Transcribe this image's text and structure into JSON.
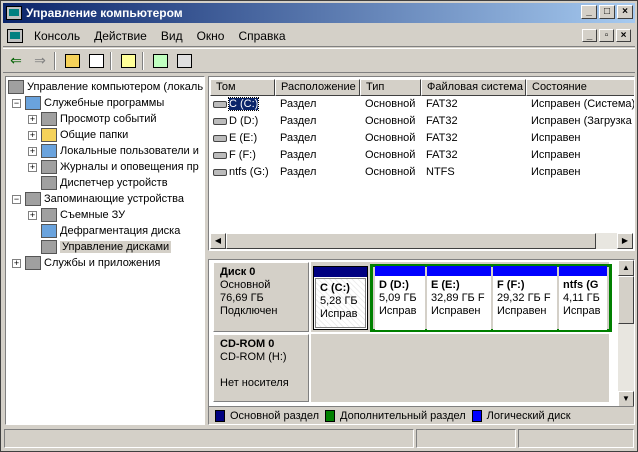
{
  "window": {
    "title": "Управление компьютером"
  },
  "menu": {
    "items": [
      "Консоль",
      "Действие",
      "Вид",
      "Окно",
      "Справка"
    ]
  },
  "tree": {
    "items": [
      {
        "label": "Управление компьютером (локаль"
      },
      {
        "label": "Служебные программы"
      },
      {
        "label": "Просмотр событий"
      },
      {
        "label": "Общие папки"
      },
      {
        "label": "Локальные пользователи и"
      },
      {
        "label": "Журналы и оповещения пр"
      },
      {
        "label": "Диспетчер устройств"
      },
      {
        "label": "Запоминающие устройства"
      },
      {
        "label": "Съемные ЗУ"
      },
      {
        "label": "Дефрагментация диска"
      },
      {
        "label": "Управление дисками"
      },
      {
        "label": "Службы и приложения"
      }
    ]
  },
  "volumes": {
    "columns": [
      "Том",
      "Расположение",
      "Тип",
      "Файловая система",
      "Состояние"
    ],
    "rows": [
      [
        "C (C:)",
        "Раздел",
        "Основной",
        "FAT32",
        "Исправен (Система)"
      ],
      [
        "D (D:)",
        "Раздел",
        "Основной",
        "FAT32",
        "Исправен (Загрузка"
      ],
      [
        "E (E:)",
        "Раздел",
        "Основной",
        "FAT32",
        "Исправен"
      ],
      [
        "F (F:)",
        "Раздел",
        "Основной",
        "FAT32",
        "Исправен"
      ],
      [
        "ntfs (G:)",
        "Раздел",
        "Основной",
        "NTFS",
        "Исправен"
      ]
    ]
  },
  "disk0": {
    "name": "Диск 0",
    "type": "Основной",
    "size": "76,69 ГБ",
    "status": "Подключен",
    "partitions": [
      {
        "name": "C (C:)",
        "size": "5,28 ГБ",
        "status": "Исправ"
      },
      {
        "name": "D (D:)",
        "size": "5,09 ГБ",
        "status": "Исправ"
      },
      {
        "name": "E (E:)",
        "size": "32,89 ГБ F",
        "status": "Исправен"
      },
      {
        "name": "F (F:)",
        "size": "29,32 ГБ F",
        "status": "Исправен"
      },
      {
        "name": "ntfs (G",
        "size": "4,11 ГБ",
        "status": "Исправ"
      }
    ]
  },
  "cdrom0": {
    "name": "CD-ROM 0",
    "type": "CD-ROM (H:)",
    "status": "Нет носителя"
  },
  "legend": [
    "Основной раздел",
    "Дополнительный раздел",
    "Логический диск"
  ],
  "colors": {
    "primary": "#000080",
    "extended": "#008000",
    "logical": "#0000ff",
    "titlebar": "#0a246a"
  }
}
